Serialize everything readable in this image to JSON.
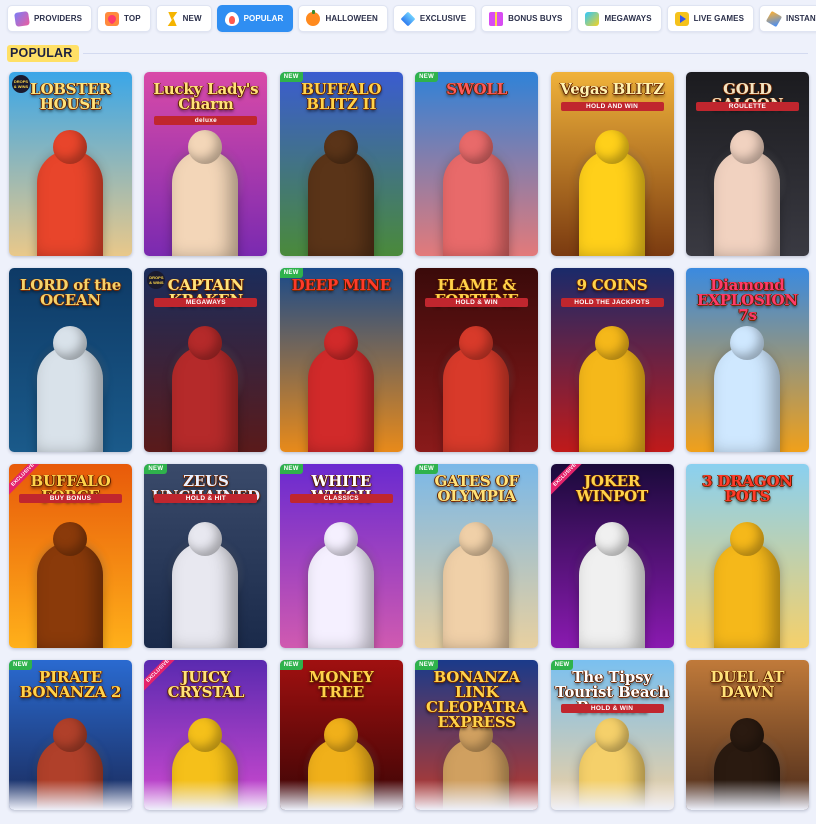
{
  "tabs": [
    {
      "label": "PROVIDERS",
      "icon": "providers-icon",
      "active": false
    },
    {
      "label": "TOP",
      "icon": "heart-icon",
      "active": false
    },
    {
      "label": "NEW",
      "icon": "lightning-icon",
      "active": false
    },
    {
      "label": "POPULAR",
      "icon": "flame-icon",
      "active": true
    },
    {
      "label": "HALLOWEEN",
      "icon": "pumpkin-icon",
      "active": false
    },
    {
      "label": "EXCLUSIVE",
      "icon": "diamond-icon",
      "active": false
    },
    {
      "label": "BONUS BUYS",
      "icon": "gift-icon",
      "active": false
    },
    {
      "label": "MEGAWAYS",
      "icon": "megaways-icon",
      "active": false
    },
    {
      "label": "LIVE GAMES",
      "icon": "play-icon",
      "active": false
    },
    {
      "label": "INSTANT GAM",
      "icon": "rocket-icon",
      "active": false
    }
  ],
  "section": {
    "title": "POPULAR"
  },
  "games": [
    {
      "title": "LOBSTER HOUSE",
      "sub": "",
      "badge": "",
      "drops": "DROPS & WINS",
      "bg1": "#3aa6e8",
      "bg2": "#e9c88a",
      "fig": "#e8452b",
      "title_color": "#ffe37a"
    },
    {
      "title": "Lucky Lady's Charm",
      "sub": "deluxe",
      "badge": "",
      "drops": "",
      "bg1": "#d94aa8",
      "bg2": "#7a2ab0",
      "fig": "#f3d6b8",
      "title_color": "#ffe37a"
    },
    {
      "title": "BUFFALO BLITZ II",
      "sub": "",
      "badge": "NEW",
      "drops": "",
      "bg1": "#3a5cd0",
      "bg2": "#4a8a3a",
      "fig": "#5a3418",
      "title_color": "#ffd34a"
    },
    {
      "title": "SWOLL",
      "sub": "",
      "badge": "NEW",
      "drops": "",
      "bg1": "#2f82d8",
      "bg2": "#e37a7a",
      "fig": "#e86a6a",
      "title_color": "#ff5a5a"
    },
    {
      "title": "Vegas BLITZ",
      "sub": "HOLD AND WIN",
      "badge": "",
      "drops": "",
      "bg1": "#f0b23a",
      "bg2": "#7a3a10",
      "fig": "#ffd01a",
      "title_color": "#fff3b0"
    },
    {
      "title": "GOLD SALOON",
      "sub": "ROULETTE",
      "badge": "",
      "drops": "",
      "bg1": "#1b1b1f",
      "bg2": "#3a3a42",
      "fig": "#f1d2c0",
      "title_color": "#f3e4c2"
    },
    {
      "title": "LORD of the OCEAN",
      "sub": "",
      "badge": "",
      "drops": "",
      "bg1": "#0e3a66",
      "bg2": "#1a5a8a",
      "fig": "#d9e2ea",
      "title_color": "#f5d36a"
    },
    {
      "title": "CAPTAIN KRAKEN",
      "sub": "MEGAWAYS",
      "badge": "",
      "drops": "DROPS & WINS",
      "bg1": "#1b2c5a",
      "bg2": "#5a1a1a",
      "fig": "#b52a2a",
      "title_color": "#ffe37a"
    },
    {
      "title": "DEEP MINE",
      "sub": "",
      "badge": "NEW",
      "drops": "",
      "bg1": "#1a4a8a",
      "bg2": "#e88a1a",
      "fig": "#d12a2a",
      "title_color": "#ff3a2a"
    },
    {
      "title": "FLAME & FORTUNE",
      "sub": "HOLD & WIN",
      "badge": "",
      "drops": "",
      "bg1": "#3a0a0a",
      "bg2": "#8a1a1a",
      "fig": "#d83a2a",
      "title_color": "#ffd34a"
    },
    {
      "title": "9 COINS",
      "sub": "HOLD THE JACKPOTS",
      "badge": "",
      "drops": "",
      "bg1": "#1a2a6a",
      "bg2": "#c01a1a",
      "fig": "#f5b81a",
      "title_color": "#ffd34a"
    },
    {
      "title": "Diamond EXPLOSION 7s",
      "sub": "",
      "badge": "",
      "drops": "",
      "bg1": "#3a8ae0",
      "bg2": "#f0a01a",
      "fig": "#cfe8ff",
      "title_color": "#ff3a6a"
    },
    {
      "title": "BUFFALO FORCE",
      "sub": "BUY BONUS",
      "badge": "EXCLUSIVE",
      "drops": "",
      "bg1": "#e85a0a",
      "bg2": "#ffb01a",
      "fig": "#8a3a0a",
      "title_color": "#ffd34a"
    },
    {
      "title": "ZEUS UNCHAINED",
      "sub": "HOLD & HIT",
      "badge": "NEW",
      "drops": "",
      "bg1": "#3a4a6a",
      "bg2": "#1a2a4a",
      "fig": "#e8e8f0",
      "title_color": "#e8f0ff"
    },
    {
      "title": "WHITE WITCH",
      "sub": "CLASSICS",
      "badge": "NEW",
      "drops": "",
      "bg1": "#6a2ad0",
      "bg2": "#d05ab0",
      "fig": "#f5f0ff",
      "title_color": "#ffffff"
    },
    {
      "title": "GATES OF OLYMPIA",
      "sub": "",
      "badge": "NEW",
      "drops": "",
      "bg1": "#7ab8e8",
      "bg2": "#e8d0a0",
      "fig": "#f0d0a8",
      "title_color": "#ffe37a"
    },
    {
      "title": "JOKER WINPOT",
      "sub": "",
      "badge": "EXCLUSIVE",
      "drops": "",
      "bg1": "#1a0a3a",
      "bg2": "#8a1ab0",
      "fig": "#f0f0f0",
      "title_color": "#ffd34a"
    },
    {
      "title": "3 DRAGON POTS",
      "sub": "",
      "badge": "",
      "drops": "",
      "bg1": "#8ad0f0",
      "bg2": "#f5d06a",
      "fig": "#f5b81a",
      "title_color": "#ff3a2a"
    },
    {
      "title": "PIRATE BONANZA 2",
      "sub": "",
      "badge": "NEW",
      "drops": "",
      "bg1": "#2a6ad0",
      "bg2": "#1a2a5a",
      "fig": "#b0402a",
      "title_color": "#ffd34a"
    },
    {
      "title": "JUICY CRYSTAL",
      "sub": "",
      "badge": "EXCLUSIVE",
      "drops": "",
      "bg1": "#5a2ab0",
      "bg2": "#d04ad0",
      "fig": "#f5c01a",
      "title_color": "#ffe37a"
    },
    {
      "title": "MONEY TREE",
      "sub": "",
      "badge": "NEW",
      "drops": "",
      "bg1": "#a01010",
      "bg2": "#3a0505",
      "fig": "#f0b01a",
      "title_color": "#ffd34a"
    },
    {
      "title": "BONANZA LINK CLEOPATRA EXPRESS",
      "sub": "",
      "badge": "NEW",
      "drops": "",
      "bg1": "#1a3a8a",
      "bg2": "#c03a2a",
      "fig": "#d0a060",
      "title_color": "#ffd34a"
    },
    {
      "title": "The Tipsy Tourist Beach Bonanza",
      "sub": "HOLD & WIN",
      "badge": "NEW",
      "drops": "",
      "bg1": "#7ac0f0",
      "bg2": "#f0d0a0",
      "fig": "#f5d06a",
      "title_color": "#ffffff"
    },
    {
      "title": "DUEL AT DAWN",
      "sub": "",
      "badge": "",
      "drops": "",
      "bg1": "#c07a3a",
      "bg2": "#4a2a1a",
      "fig": "#2a1a10",
      "title_color": "#ffe37a"
    }
  ]
}
